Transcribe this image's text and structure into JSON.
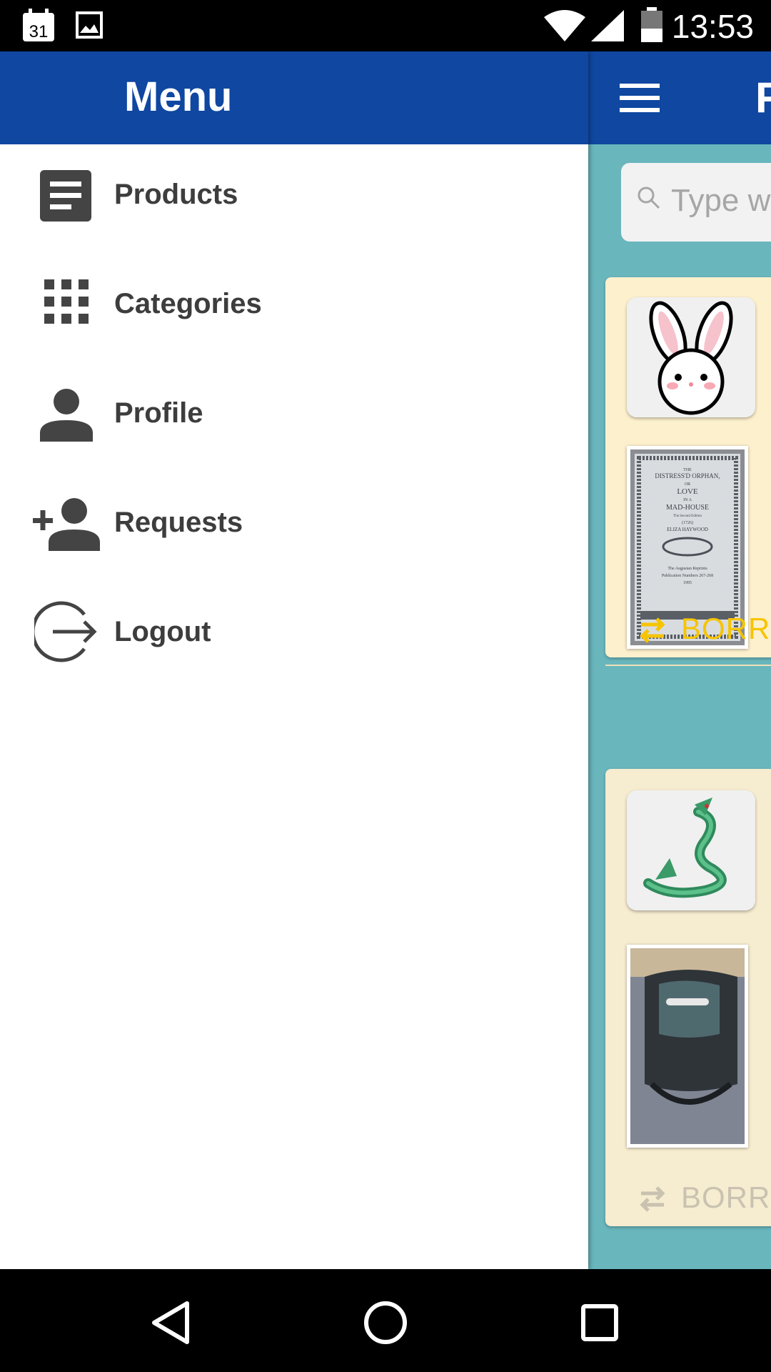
{
  "status_bar": {
    "time": "13:53",
    "calendar_day": "31",
    "icons": [
      "calendar-icon",
      "image-icon",
      "wifi-icon",
      "signal-icon",
      "battery-icon"
    ]
  },
  "app_bar": {
    "title_peek": "F"
  },
  "search": {
    "placeholder": "Type wo"
  },
  "cards": [
    {
      "action_label": "BORRO",
      "thumb": "bunny-image",
      "photo": "book-photo"
    },
    {
      "action_label": "BORRO",
      "thumb": "dragon-image",
      "photo": "backpack-photo"
    }
  ],
  "book_photo": {
    "lines": [
      "THE",
      "DISTRESS'D ORPHAN,",
      "OR",
      "LOVE",
      "IN A",
      "MAD-HOUSE",
      "The Second Edition",
      "(1726)",
      "ELIZA HAYWOOD",
      "The Augustan Reprints",
      "Publication Numbers 267-268",
      "1995"
    ]
  },
  "drawer": {
    "title": "Menu",
    "items": [
      {
        "label": "Products",
        "icon": "article-icon"
      },
      {
        "label": "Categories",
        "icon": "grid-icon"
      },
      {
        "label": "Profile",
        "icon": "person-icon"
      },
      {
        "label": "Requests",
        "icon": "person-add-icon"
      },
      {
        "label": "Logout",
        "icon": "logout-icon"
      }
    ]
  },
  "colors": {
    "primary": "#0f47a1",
    "background": "#69b6bd",
    "card": "#fdf0cd",
    "accent": "#f6c400",
    "drawer_text": "#3d3d3d"
  }
}
